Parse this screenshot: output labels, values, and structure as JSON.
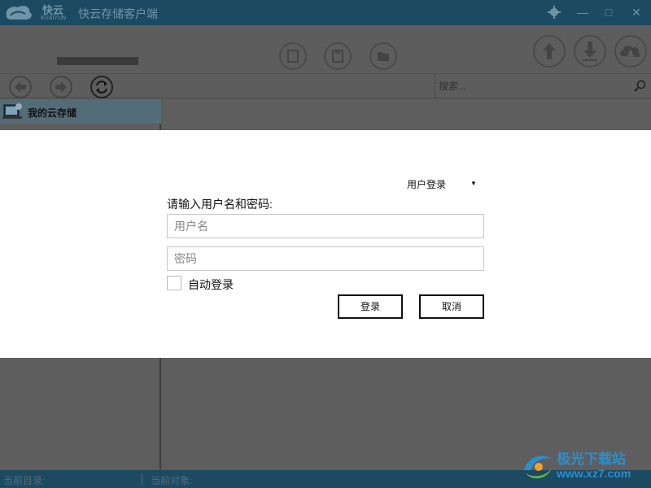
{
  "window": {
    "logo_text": "快云",
    "logo_subtext": "KUAIYUN",
    "title": "快云存储客户端"
  },
  "search": {
    "placeholder": "搜索..."
  },
  "sidebar": {
    "items": [
      {
        "label": "我的云存储"
      }
    ]
  },
  "statusbar": {
    "current_dir_label": "当前目录:",
    "current_object_label": "当前对象:"
  },
  "login_dialog": {
    "mode": "用户登录",
    "prompt": "请输入用户名和密码:",
    "username_placeholder": "用户名",
    "password_placeholder": "密码",
    "auto_login_label": "自动登录",
    "login_button": "登录",
    "cancel_button": "取消"
  },
  "watermark": {
    "text": "极光下载站",
    "url": "www.xz7.com"
  },
  "colors": {
    "titlebar": "#1d4a63",
    "sidebar_selected": "#546b78",
    "watermark": "#2a8fd0"
  }
}
